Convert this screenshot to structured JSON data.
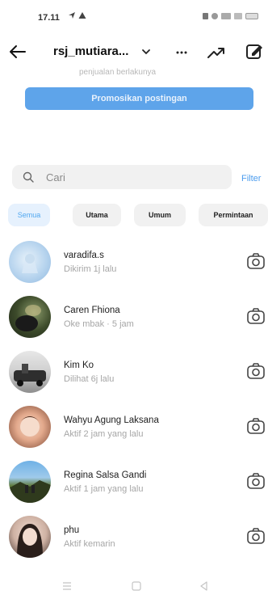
{
  "status_bar": {
    "time": "17.11"
  },
  "header": {
    "username": "rsj_mutiara...",
    "more_label": "···"
  },
  "promo": {
    "faded_text": "penjualan berlakunya",
    "button_label": "Promosikan postingan"
  },
  "search": {
    "placeholder": "Cari",
    "filter_label": "Filter"
  },
  "tabs": [
    {
      "label": "Semua",
      "active": true
    },
    {
      "label": "Utama",
      "active": false
    },
    {
      "label": "Umum",
      "active": false
    },
    {
      "label": "Permintaan",
      "active": false
    }
  ],
  "conversations": [
    {
      "name": "varadifa.s",
      "status": "Dikirim 1j lalu",
      "avatar": "light-blue-photo"
    },
    {
      "name": "Caren Fhiona",
      "status": "Oke mbak · 5 jam",
      "avatar": "dark-green-photo"
    },
    {
      "name": "Kim Ko",
      "status": "Dilihat 6j lalu",
      "avatar": "grey-car-photo"
    },
    {
      "name": "Wahyu Agung Laksana",
      "status": "Aktif 2 jam yang lalu",
      "avatar": "child-photo"
    },
    {
      "name": "Regina Salsa Gandi",
      "status": "Aktif 1 jam yang lalu",
      "avatar": "landscape-photo"
    },
    {
      "name": "phu",
      "status": "Aktif kemarin",
      "avatar": "portrait-photo"
    }
  ],
  "colors": {
    "accent": "#4b9cee",
    "promo_button": "#5ea4ea",
    "chip_bg": "#f1f1f1",
    "active_chip_bg": "#e6f1fd"
  }
}
